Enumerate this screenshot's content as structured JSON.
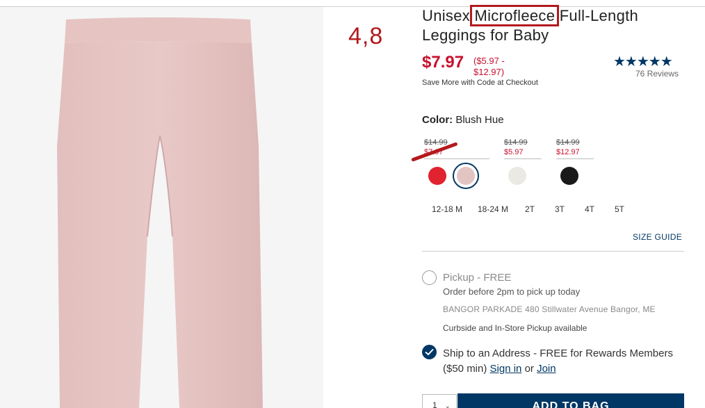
{
  "annotation": {
    "rating_number": "4,8"
  },
  "product": {
    "title_pre": "Unisex",
    "title_highlight": "Microfleece",
    "title_post": "Full-Length Leggings for Baby",
    "price": "$7.97",
    "price_range": "($5.97 - $12.97)",
    "promo": "Save More with Code at Checkout",
    "stars": "★★★★★",
    "reviews": "76 Reviews",
    "rating_value": 4.8
  },
  "color": {
    "label": "Color:",
    "value": "Blush Hue",
    "price_groups": [
      {
        "was": "$14.99",
        "now": "$7.97"
      },
      {
        "was": "$14.99",
        "now": "$5.97"
      },
      {
        "was": "$14.99",
        "now": "$12.97"
      }
    ],
    "swatches": [
      {
        "name": "red",
        "hex": "#e1222f"
      },
      {
        "name": "blush-hue",
        "hex": "#e2c5c2",
        "selected": true
      },
      {
        "name": "cream",
        "hex": "#ebe9e3"
      },
      {
        "name": "black",
        "hex": "#1a1a1a"
      }
    ]
  },
  "sizes": [
    "12-18 M",
    "18-24 M",
    "2T",
    "3T",
    "4T",
    "5T"
  ],
  "size_guide": "SIZE GUIDE",
  "pickup": {
    "title": "Pickup - FREE",
    "subtitle": "Order before 2pm to pick up today",
    "store": "BANGOR PARKADE 480 Stillwater Avenue  Bangor, ME",
    "curbside": "Curbside and In-Store Pickup available"
  },
  "shipping": {
    "text_a": "Ship to an Address - FREE for Rewards Members ($50 min)",
    "sign_in": "Sign in",
    "or": "or",
    "join": "Join"
  },
  "cart": {
    "qty": "1",
    "add_label": "ADD TO BAG"
  },
  "colors": {
    "brand_navy": "#003764",
    "sale_red": "#c8102e",
    "annotation_red": "#b3191d"
  }
}
